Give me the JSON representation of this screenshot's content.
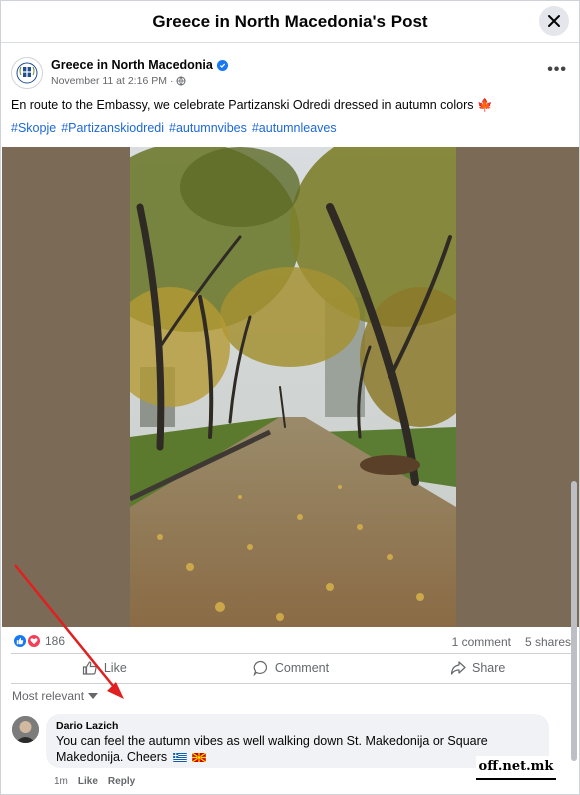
{
  "header": {
    "title": "Greece in North Macedonia's Post"
  },
  "post": {
    "author": "Greece in North Macedonia",
    "timestamp": "November 11 at 2:16 PM",
    "caption": "En route to the Embassy, we celebrate Partizanski Odredi dressed in autumn colors",
    "caption_emoji": "🍁",
    "hashtags": [
      "#Skopje",
      "#Partizanskiodredi",
      "#autumnvibes",
      "#autumnleaves"
    ],
    "reaction_count": "186",
    "comment_count": "1 comment",
    "share_count": "5 shares"
  },
  "actions": {
    "like": "Like",
    "comment": "Comment",
    "share": "Share"
  },
  "sort": {
    "label": "Most relevant"
  },
  "comment": {
    "name": "Dario Lazich",
    "text": "You can feel the autumn vibes as well walking down St. Makedonija or Square Makedonija. Cheers",
    "age": "1m",
    "like": "Like",
    "reply": "Reply"
  },
  "watermark": "off.net.mk",
  "colors": {
    "link": "#1d68d8",
    "like_blue": "#1877f2",
    "love_red": "#f33e58",
    "arrow_red": "#e02020",
    "photo_bg": "#7b6a55"
  }
}
